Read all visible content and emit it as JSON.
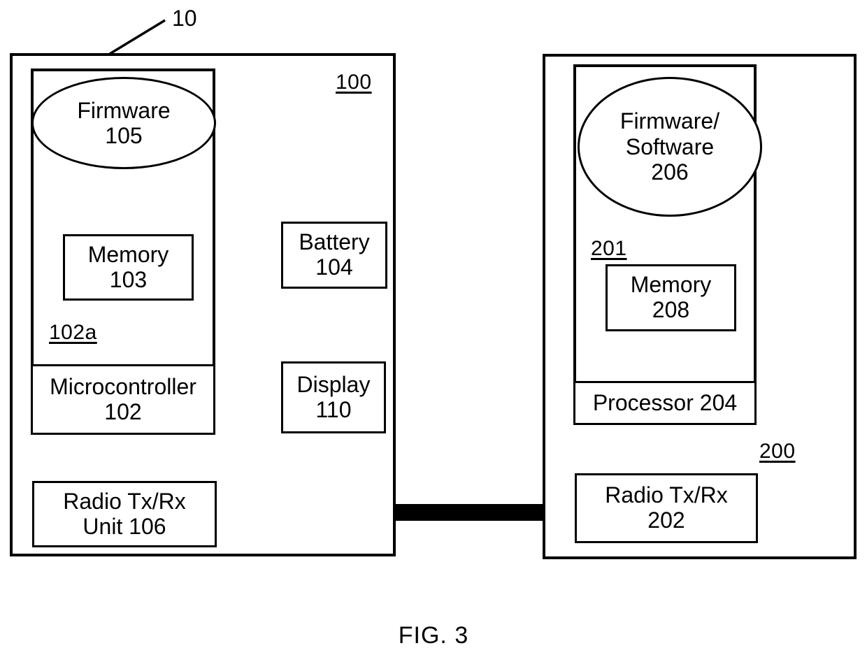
{
  "figure": {
    "caption": "FIG. 3",
    "system_ref": "10"
  },
  "left_device": {
    "ref": "100",
    "inner_module_ref": "102a",
    "firmware": {
      "name": "Firmware",
      "ref": "105"
    },
    "memory": {
      "name": "Memory",
      "ref": "103"
    },
    "microcontroller": {
      "name": "Microcontroller",
      "ref": "102"
    },
    "battery": {
      "name": "Battery",
      "ref": "104"
    },
    "display": {
      "name": "Display",
      "ref": "110"
    },
    "radio": {
      "name_line1": "Radio Tx/Rx",
      "name_line2": "Unit 106"
    }
  },
  "right_device": {
    "ref": "200",
    "inner_module_ref": "201",
    "firmware": {
      "name_line1": "Firmware/",
      "name_line2": "Software",
      "ref": "206"
    },
    "memory": {
      "name": "Memory",
      "ref": "208"
    },
    "processor": {
      "name": "Processor 204"
    },
    "radio": {
      "name": "Radio Tx/Rx",
      "ref": "202"
    }
  },
  "colors": {
    "stroke": "#000000",
    "background": "#ffffff"
  }
}
